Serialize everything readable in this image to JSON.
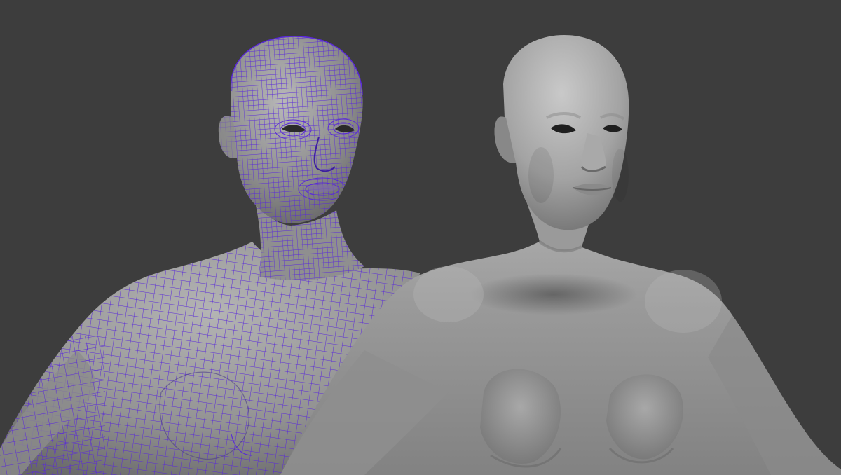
{
  "viewport": {
    "background_color": "#3d3d3d",
    "wireframe_color": "#5a2ad8",
    "skin_color": "#9b9b9b",
    "skin_highlight": "#c2c2c2",
    "skin_shadow": "#5e5e5e"
  },
  "models": [
    {
      "id": "wireframe-model",
      "shading": "wireframe-on-shaded"
    },
    {
      "id": "shaded-model",
      "shading": "smooth-shaded"
    }
  ]
}
